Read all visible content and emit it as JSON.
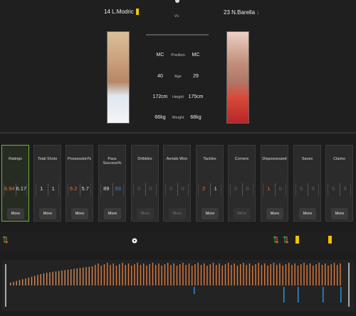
{
  "match": {
    "vs": "vs",
    "left_player": {
      "name": "14 L.Modric",
      "card_color": "#f2c200"
    },
    "right_player": {
      "name": "23 N.Barella",
      "sub_color": "#e24a3b"
    }
  },
  "comparison": [
    {
      "label": "Position",
      "left": "MC",
      "right": "MC"
    },
    {
      "label": "Age",
      "left": "40",
      "right": "29"
    },
    {
      "label": "Height",
      "left": "172cm",
      "right": "175cm"
    },
    {
      "label": "Weight",
      "left": "66kg",
      "right": "68kg"
    }
  ],
  "stat_cards": [
    {
      "title": "Ratings",
      "left": "6.94",
      "right": "6.17",
      "left_color": "orange",
      "right_color": "",
      "more": "More",
      "active": true,
      "disabled": false
    },
    {
      "title": "Total Shots",
      "left": "1",
      "right": "1",
      "left_color": "",
      "right_color": "",
      "more": "More",
      "active": false,
      "disabled": false
    },
    {
      "title": "Possession%",
      "left": "6.2",
      "right": "5.7",
      "left_color": "orange",
      "right_color": "",
      "more": "More",
      "active": false,
      "disabled": false
    },
    {
      "title": "Pass Success%",
      "left": "89",
      "right": "93",
      "left_color": "",
      "right_color": "blue",
      "more": "More",
      "active": false,
      "disabled": false
    },
    {
      "title": "Dribbles",
      "left": "0",
      "right": "0",
      "left_color": "grey",
      "right_color": "grey",
      "more": "More",
      "active": false,
      "disabled": true
    },
    {
      "title": "Aerials Won",
      "left": "0",
      "right": "0",
      "left_color": "grey",
      "right_color": "grey",
      "more": "More",
      "active": false,
      "disabled": true
    },
    {
      "title": "Tackles",
      "left": "2",
      "right": "1",
      "left_color": "orange",
      "right_color": "",
      "more": "More",
      "active": false,
      "disabled": false
    },
    {
      "title": "Corners",
      "left": "0",
      "right": "0",
      "left_color": "grey",
      "right_color": "grey",
      "more": "More",
      "active": false,
      "disabled": true
    },
    {
      "title": "Dispossessed",
      "left": "1",
      "right": "0",
      "left_color": "orange",
      "right_color": "grey",
      "more": "More",
      "active": false,
      "disabled": false
    },
    {
      "title": "Saves",
      "left": "0",
      "right": "0",
      "left_color": "grey",
      "right_color": "grey",
      "more": "More",
      "active": false,
      "disabled": false
    },
    {
      "title": "Claims",
      "left": "0",
      "right": "0",
      "left_color": "grey",
      "right_color": "grey",
      "more": "More",
      "active": false,
      "disabled": false
    }
  ],
  "timeline": {
    "events": [
      {
        "type": "substitution",
        "icon": "sub-arrows-icon",
        "color": "#3cb043"
      },
      {
        "type": "goal",
        "icon": "ball-icon",
        "color": "#ffffff"
      },
      {
        "type": "substitution",
        "icon": "sub-arrows-icon",
        "color": "#3cb043"
      },
      {
        "type": "substitution",
        "icon": "sub-arrows-icon",
        "color": "#3cb043"
      },
      {
        "type": "yellow-card",
        "icon": "yellow-card-icon",
        "color": "#f2c200"
      },
      {
        "type": "yellow-card",
        "icon": "yellow-card-icon",
        "color": "#f2c200"
      }
    ]
  },
  "colors": {
    "accent_orange": "#e8703a",
    "accent_blue": "#2f8ee0",
    "active_green": "#6ab43a"
  }
}
